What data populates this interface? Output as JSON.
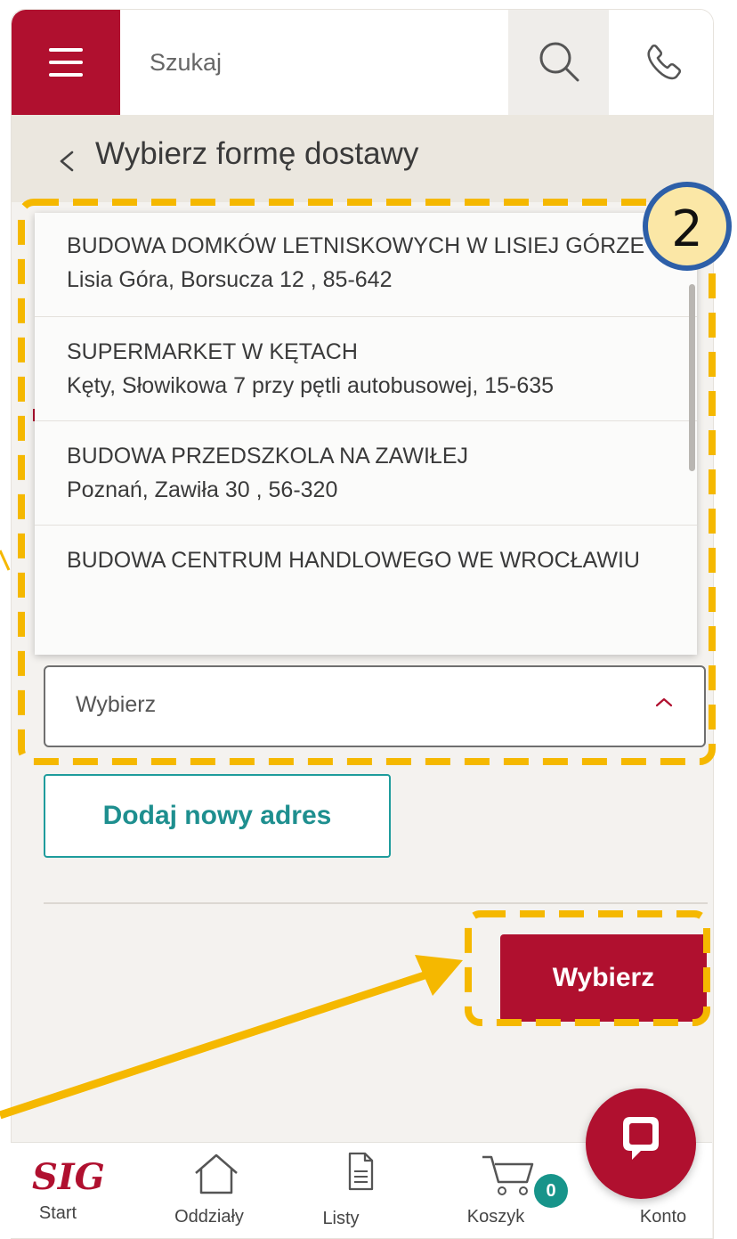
{
  "header": {
    "search_placeholder": "Szukaj",
    "accent_color": "#b0102f"
  },
  "subheader": {
    "title": "Wybierz formę dostawy"
  },
  "address_dropdown": {
    "options": [
      {
        "name": "BUDOWA DOMKÓW LETNISKOWYCH W LISIEJ GÓRZE",
        "address": "Lisia Góra, Borsucza 12 , 85-642"
      },
      {
        "name": "SUPERMARKET W KĘTACH",
        "address": "Kęty, Słowikowa 7 przy pętli autobusowej, 15-635"
      },
      {
        "name": "BUDOWA PRZEDSZKOLA NA ZAWIŁEJ",
        "address": "Poznań, Zawiła 30 , 56-320"
      },
      {
        "name": "BUDOWA CENTRUM HANDLOWEGO WE WROCŁAWIU",
        "address": ""
      }
    ],
    "selected_value": "Wybierz"
  },
  "buttons": {
    "add_address": "Dodaj nowy adres",
    "choose": "Wybierz"
  },
  "annotation": {
    "step_number": "2",
    "highlight_color": "#f5b800",
    "circle_color": "#fbe7a6"
  },
  "tabbar": {
    "start_logo": "SIG",
    "start": "Start",
    "branches": "Oddziały",
    "lists": "Listy",
    "cart": "Koszyk",
    "cart_count": "0",
    "account": "Konto"
  },
  "icons": [
    "menu-icon",
    "search-icon",
    "phone-icon",
    "chevron-left-icon",
    "chevron-up-icon",
    "house-icon",
    "document-icon",
    "cart-icon",
    "chat-icon"
  ]
}
